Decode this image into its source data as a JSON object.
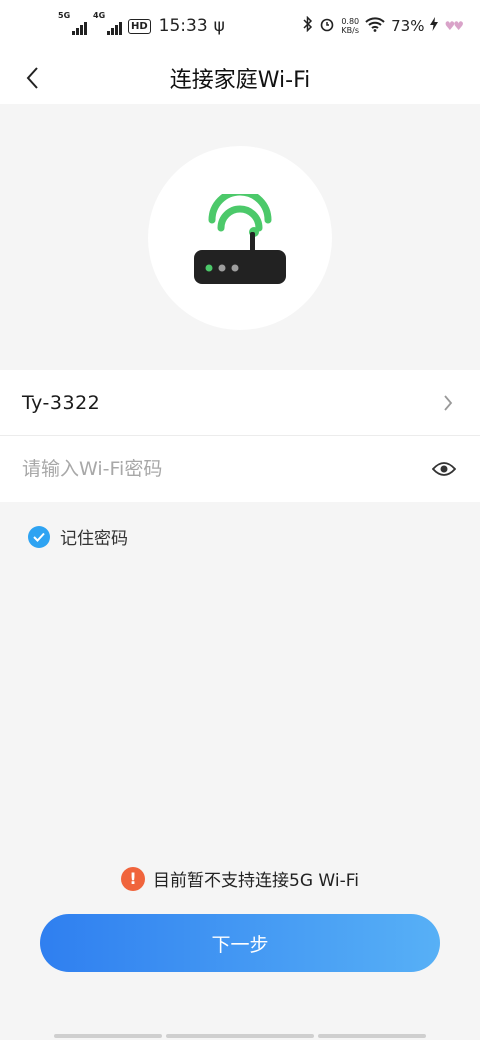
{
  "status_bar": {
    "net1": "5G",
    "net2": "4G",
    "hd": "HD",
    "time": "15:33",
    "usb": "ψ",
    "speed_value": "0.80",
    "speed_unit": "KB/s",
    "battery": "73%"
  },
  "header": {
    "title": "连接家庭Wi-Fi"
  },
  "form": {
    "ssid": "Ty-3322",
    "password_placeholder": "请输入Wi-Fi密码",
    "password_value": ""
  },
  "remember": {
    "label": "记住密码",
    "checked": true
  },
  "warning": {
    "icon": "!",
    "text": "目前暂不支持连接5G Wi-Fi"
  },
  "next_button": {
    "label": "下一步"
  },
  "colors": {
    "accent": "#2ea3f2",
    "wifi_green": "#4cc96a",
    "warning": "#f0643c",
    "button_start": "#2f7ff0",
    "button_end": "#57b0f6"
  }
}
